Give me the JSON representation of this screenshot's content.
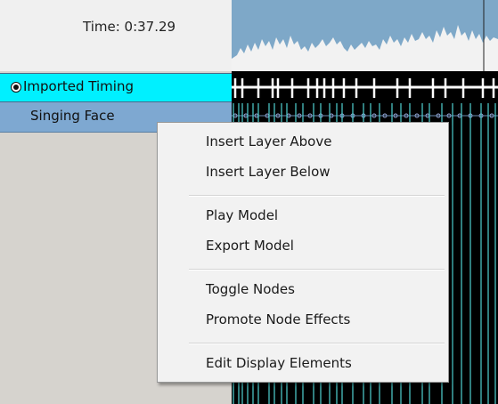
{
  "header": {
    "time_label": "Time: 0:37.29"
  },
  "rows": [
    {
      "label": "Imported Timing",
      "color": "#00f0ff",
      "active": true
    },
    {
      "label": "Singing Face",
      "color": "#7ea8d1",
      "active": false
    }
  ],
  "context_menu": {
    "items": [
      {
        "label": "Insert Layer Above"
      },
      {
        "label": "Insert Layer Below"
      },
      {
        "label": "Play Model"
      },
      {
        "label": "Export Model"
      },
      {
        "label": "Toggle Nodes"
      },
      {
        "label": "Promote Node Effects"
      },
      {
        "label": "Edit Display Elements"
      }
    ]
  },
  "colors": {
    "waveform_bg": "#7ea8c8",
    "waveform": "#ffffff",
    "effect_line": "#4fd3d3",
    "timeline_bg": "#000000"
  }
}
